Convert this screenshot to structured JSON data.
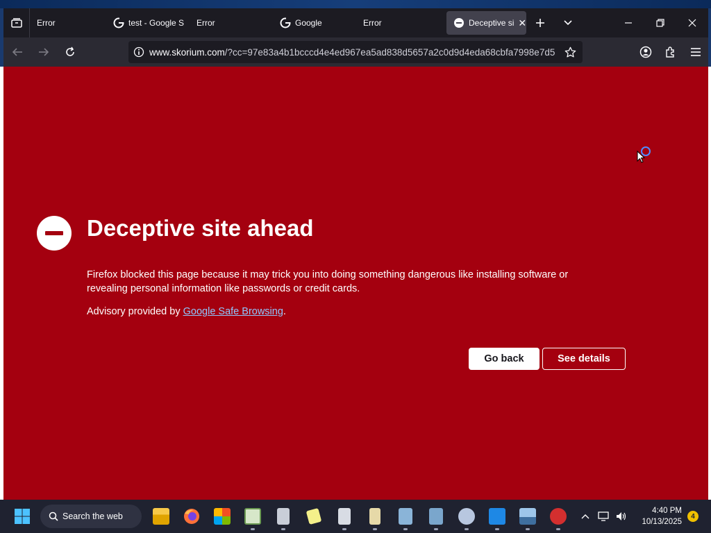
{
  "tabs": [
    {
      "title": "Error",
      "favicon": "none",
      "active": false
    },
    {
      "title": "test - Google S",
      "favicon": "google-icon",
      "active": false
    },
    {
      "title": "Error",
      "favicon": "none",
      "active": false
    },
    {
      "title": "Google",
      "favicon": "google-icon",
      "active": false
    },
    {
      "title": "Error",
      "favicon": "none",
      "active": false
    },
    {
      "title": "Deceptive si",
      "favicon": "blocked-icon",
      "active": true
    }
  ],
  "url": {
    "host": "www.skorium.com",
    "path": "/?cc=97e83a4b1bcccd4e4ed967ea5ad838d5657a2c0d9d4eda68cbfa7998e7d5"
  },
  "page": {
    "title": "Deceptive site ahead",
    "description": "Firefox blocked this page because it may trick you into doing something dangerous like installing software or revealing personal information like passwords or credit cards.",
    "advisory_prefix": "Advisory provided by ",
    "advisory_link": "Google Safe Browsing",
    "advisory_suffix": ".",
    "go_back_label": "Go back",
    "see_details_label": "See details"
  },
  "taskbar": {
    "search_label": "Search the web",
    "time": "4:40 PM",
    "date": "10/13/2025",
    "notification_count": "4"
  },
  "colors": {
    "warning_bg": "#a4000f",
    "link": "#8fc7ff",
    "tab_active": "#42414d"
  }
}
